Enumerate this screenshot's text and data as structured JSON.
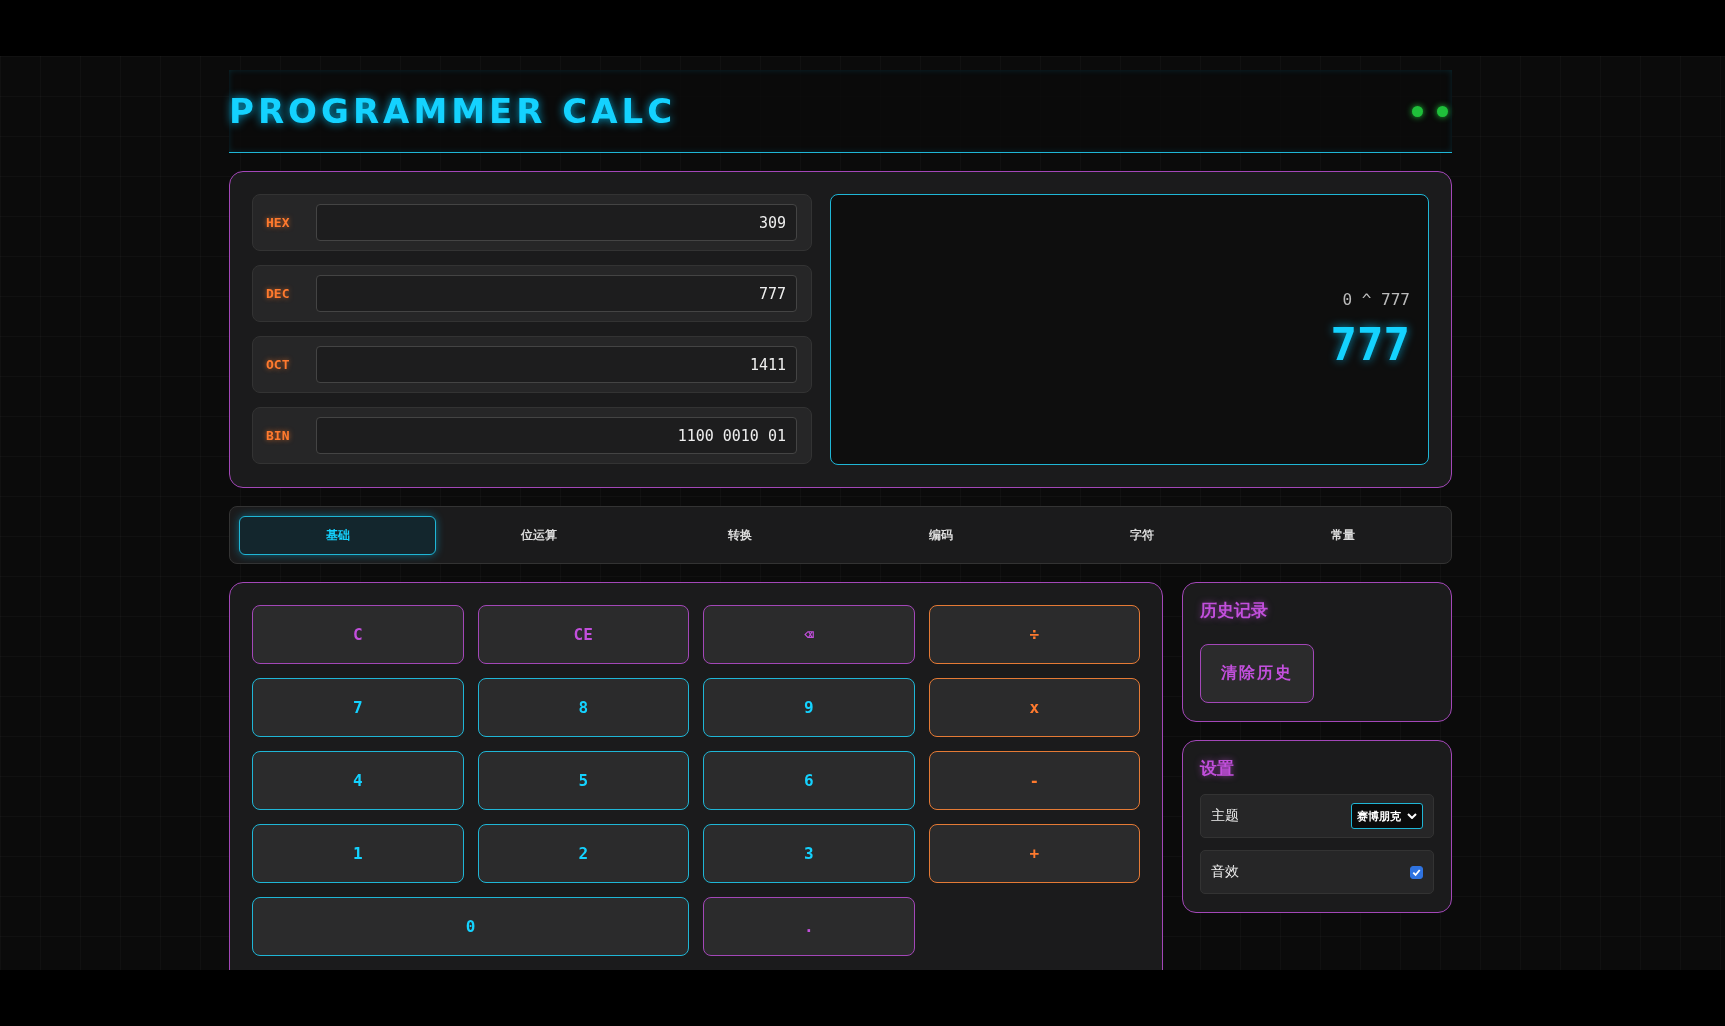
{
  "header": {
    "title": "PROGRAMMER CALC"
  },
  "converter": [
    {
      "base": "HEX",
      "value": "309"
    },
    {
      "base": "DEC",
      "value": "777"
    },
    {
      "base": "OCT",
      "value": "1411"
    },
    {
      "base": "BIN",
      "value": "1100 0010 01"
    }
  ],
  "display": {
    "expression": "0 ^ 777",
    "result": "777"
  },
  "tabs": [
    {
      "label": "基础",
      "selected": true
    },
    {
      "label": "位运算",
      "selected": false
    },
    {
      "label": "转换",
      "selected": false
    },
    {
      "label": "编码",
      "selected": false
    },
    {
      "label": "字符",
      "selected": false
    },
    {
      "label": "常量",
      "selected": false
    }
  ],
  "keys": [
    {
      "label": "C",
      "kind": "function"
    },
    {
      "label": "CE",
      "kind": "function"
    },
    {
      "label": "⌫",
      "kind": "function"
    },
    {
      "label": "÷",
      "kind": "operator"
    },
    {
      "label": "7",
      "kind": "digit"
    },
    {
      "label": "8",
      "kind": "digit"
    },
    {
      "label": "9",
      "kind": "digit"
    },
    {
      "label": "x",
      "kind": "operator"
    },
    {
      "label": "4",
      "kind": "digit"
    },
    {
      "label": "5",
      "kind": "digit"
    },
    {
      "label": "6",
      "kind": "digit"
    },
    {
      "label": "-",
      "kind": "operator"
    },
    {
      "label": "1",
      "kind": "digit"
    },
    {
      "label": "2",
      "kind": "digit"
    },
    {
      "label": "3",
      "kind": "digit"
    },
    {
      "label": "+",
      "kind": "operator"
    },
    {
      "label": "0",
      "kind": "wide_digit"
    },
    {
      "label": ".",
      "kind": "function"
    }
  ],
  "history": {
    "title": "历史记录",
    "clear_button": "清除历史"
  },
  "settings": {
    "title": "设置",
    "items": [
      {
        "kind": "select",
        "label": "主题",
        "value": "赛博朋克"
      },
      {
        "kind": "checkbox",
        "label": "音效",
        "checked": true
      }
    ]
  }
}
